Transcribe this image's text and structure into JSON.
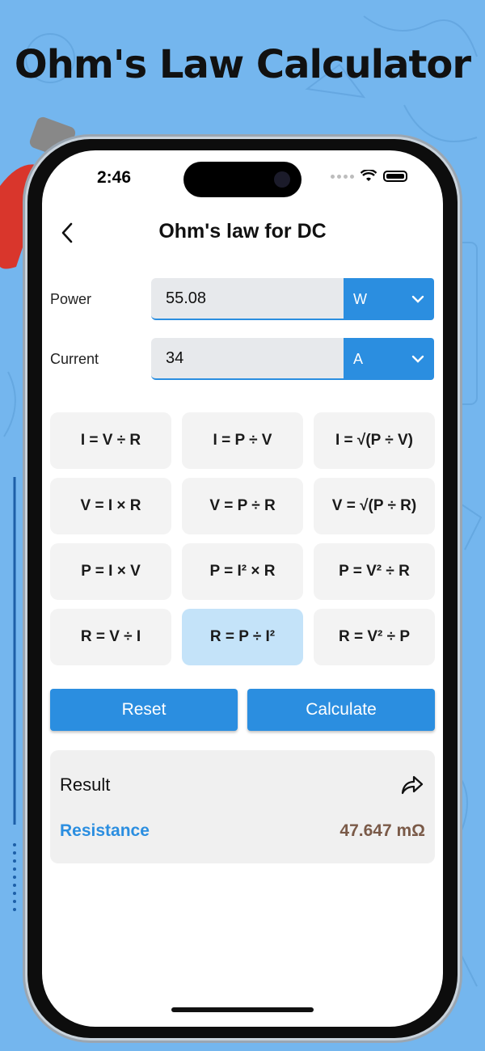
{
  "hero": {
    "title": "Ohm's Law Calculator"
  },
  "status_bar": {
    "time": "2:46"
  },
  "nav": {
    "title": "Ohm's law for DC",
    "back_icon": "chevron-left-icon"
  },
  "inputs": [
    {
      "label": "Power",
      "value": "55.08",
      "unit": "W"
    },
    {
      "label": "Current",
      "value": "34",
      "unit": "A"
    }
  ],
  "formulas": [
    {
      "label": "I = V ÷ R",
      "selected": false
    },
    {
      "label": "I = P ÷ V",
      "selected": false
    },
    {
      "label": "I = √(P ÷ V)",
      "selected": false
    },
    {
      "label": "V = I × R",
      "selected": false
    },
    {
      "label": "V = P ÷ R",
      "selected": false
    },
    {
      "label": "V = √(P ÷ R)",
      "selected": false
    },
    {
      "label": "P = I × V",
      "selected": false
    },
    {
      "label": "P = I² × R",
      "selected": false
    },
    {
      "label": "P = V² ÷ R",
      "selected": false
    },
    {
      "label": "R = V ÷ I",
      "selected": false
    },
    {
      "label": "R = P ÷ I²",
      "selected": true
    },
    {
      "label": "R = V² ÷ P",
      "selected": false
    }
  ],
  "actions": {
    "reset_label": "Reset",
    "calculate_label": "Calculate"
  },
  "result": {
    "title": "Result",
    "name": "Resistance",
    "value": "47.647 mΩ",
    "share_icon": "share-icon"
  },
  "colors": {
    "background": "#74b6ee",
    "accent": "#2b8ee0",
    "selected_formula": "#c4e3f9",
    "result_value": "#7a5a48"
  }
}
